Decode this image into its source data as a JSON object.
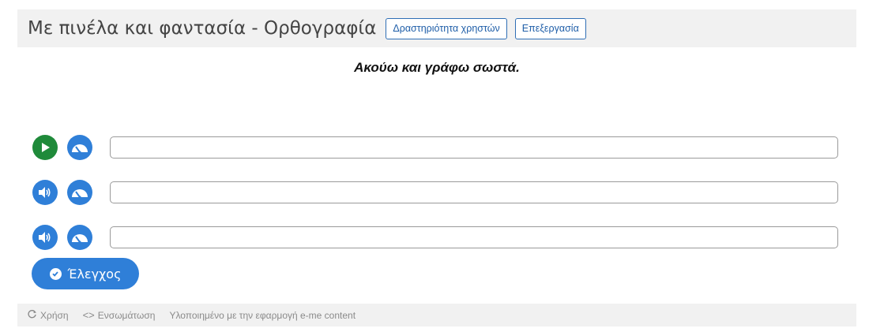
{
  "header": {
    "title": "Με πινέλα και φαντασία - Ορθογραφία",
    "buttons": [
      "Δραστηριότητα χρηστών",
      "Επεξεργασία"
    ]
  },
  "content": {
    "instruction": "Ακούω και γράφω σωστά.",
    "rows": [
      {
        "play_icon": "play-icon",
        "speed_icon": "speedometer-icon",
        "value": ""
      },
      {
        "play_icon": "speaker-icon",
        "speed_icon": "speedometer-icon",
        "value": ""
      },
      {
        "play_icon": "speaker-icon",
        "speed_icon": "speedometer-icon",
        "value": ""
      }
    ],
    "check_label": "Έλεγχος"
  },
  "footer": {
    "reuse_label": "Χρήση",
    "embed_label": "Ενσωμάτωση",
    "credit": "Υλοποιημένο με την εφαρμογή e-me content"
  },
  "colors": {
    "accent_blue": "#2f7fd8",
    "play_green": "#1f8a3a",
    "button_border": "#2f6fb5"
  }
}
